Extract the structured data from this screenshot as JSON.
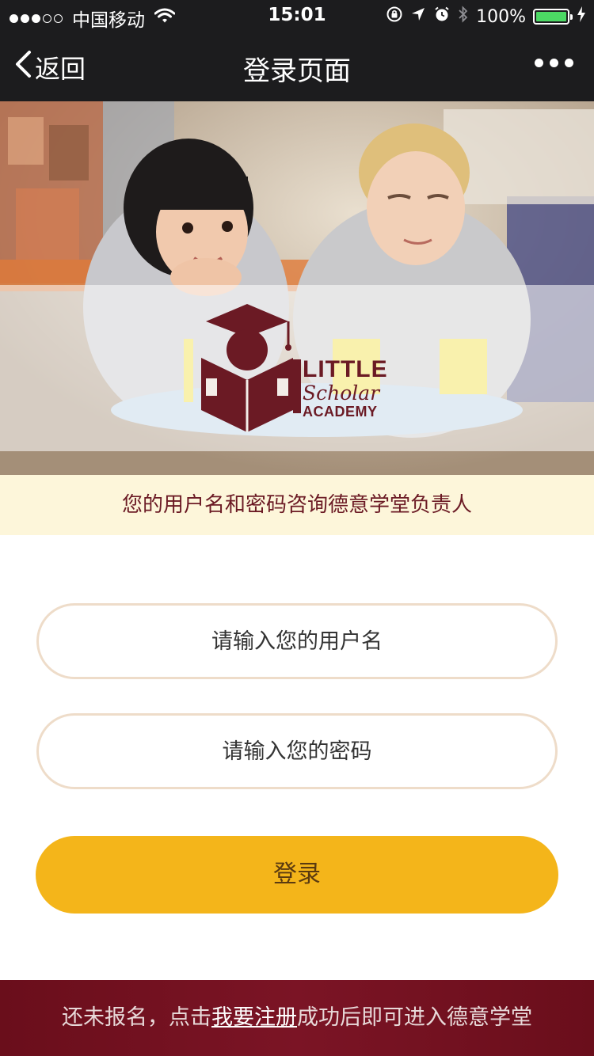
{
  "status_bar": {
    "carrier": "中国移动",
    "time": "15:01",
    "battery": "100%",
    "battery_level": 1.0,
    "signal_bars_filled": 3,
    "signal_bars_total": 5,
    "icons": [
      "wifi-icon",
      "rotation-lock-icon",
      "location-icon",
      "alarm-icon",
      "bluetooth-icon",
      "battery-icon",
      "charging-icon"
    ]
  },
  "navbar": {
    "back_label": "返回",
    "title": "登录页面",
    "more_icon": "more-dots-icon"
  },
  "hero": {
    "logo": {
      "line1": "LITTLE",
      "line2": "Scholar",
      "line3": "ACADEMY"
    }
  },
  "notice": "您的用户名和密码咨询德意学堂负责人",
  "form": {
    "username_placeholder": "请输入您的用户名",
    "username_value": "",
    "password_placeholder": "请输入您的密码",
    "password_value": "",
    "login_label": "登录"
  },
  "footer": {
    "prefix": "还未报名，点击",
    "link": "我要注册",
    "suffix": "成功后即可进入德意学堂"
  },
  "colors": {
    "bar_bg": "#1c1c1e",
    "brand_maroon": "#6b1a24",
    "notice_bg": "#fdf6da",
    "field_border": "#eedcc9",
    "login_button": "#f4b51a",
    "footer_bg": "#6a0e1b",
    "battery_green": "#4cd964"
  }
}
